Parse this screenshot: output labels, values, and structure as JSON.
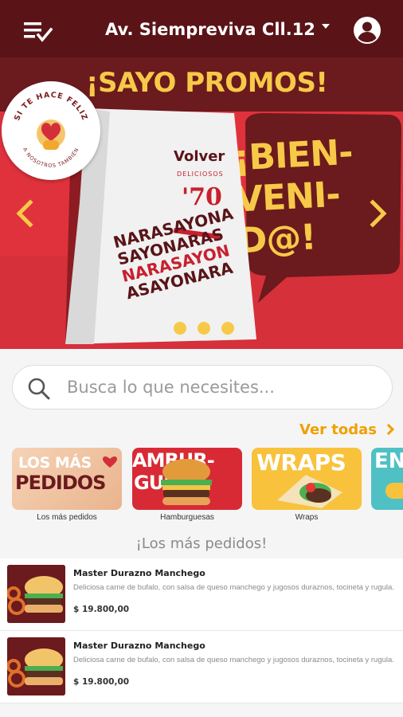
{
  "header": {
    "address": "Av. Siempreviva Cll.12"
  },
  "banner": {
    "title": "¡SAYO PROMOS!",
    "seal_text_top": "SI TE HACE FELIZ",
    "seal_text_bottom": "A NOSOTROS TAMBIÉN",
    "bag_label": "Volver",
    "bag_brand": "'70",
    "bag_small": "DELICIOSOS",
    "bag_words": [
      "NARASAYONA",
      "SAYONARAS",
      "NARASAYON",
      "ASAYONARA"
    ],
    "bubble_text": "¡BIEN-\nVENI-\nD@!",
    "dots": 3,
    "colors": {
      "red": "#e0323c",
      "dark": "#6b1a1d",
      "yellow": "#f7c948"
    }
  },
  "search": {
    "placeholder": "Busca lo que necesites..."
  },
  "see_all": "Ver todas",
  "categories": [
    {
      "title": "LOS MÁS PEDIDOS",
      "label": "Los más pedidos"
    },
    {
      "title": "AMBUR-GUESA",
      "label": "Hamburguesas"
    },
    {
      "title": "WRAPS",
      "label": "Wraps"
    },
    {
      "title": "EN",
      "label": ""
    }
  ],
  "section_title": "¡Los más pedidos!",
  "products": [
    {
      "name": "Master Durazno Manchego",
      "description": "Deliciosa carne de bufalo, con salsa de queso manchego y jugosos duraznos, tocineta y rugula.",
      "price": "$ 19.800,00"
    },
    {
      "name": "Master Durazno Manchego",
      "description": "Deliciosa carne de bufalo, con salsa de queso manchego y jugosos duraznos, tocineta y rugula.",
      "price": "$ 19.800,00"
    }
  ]
}
